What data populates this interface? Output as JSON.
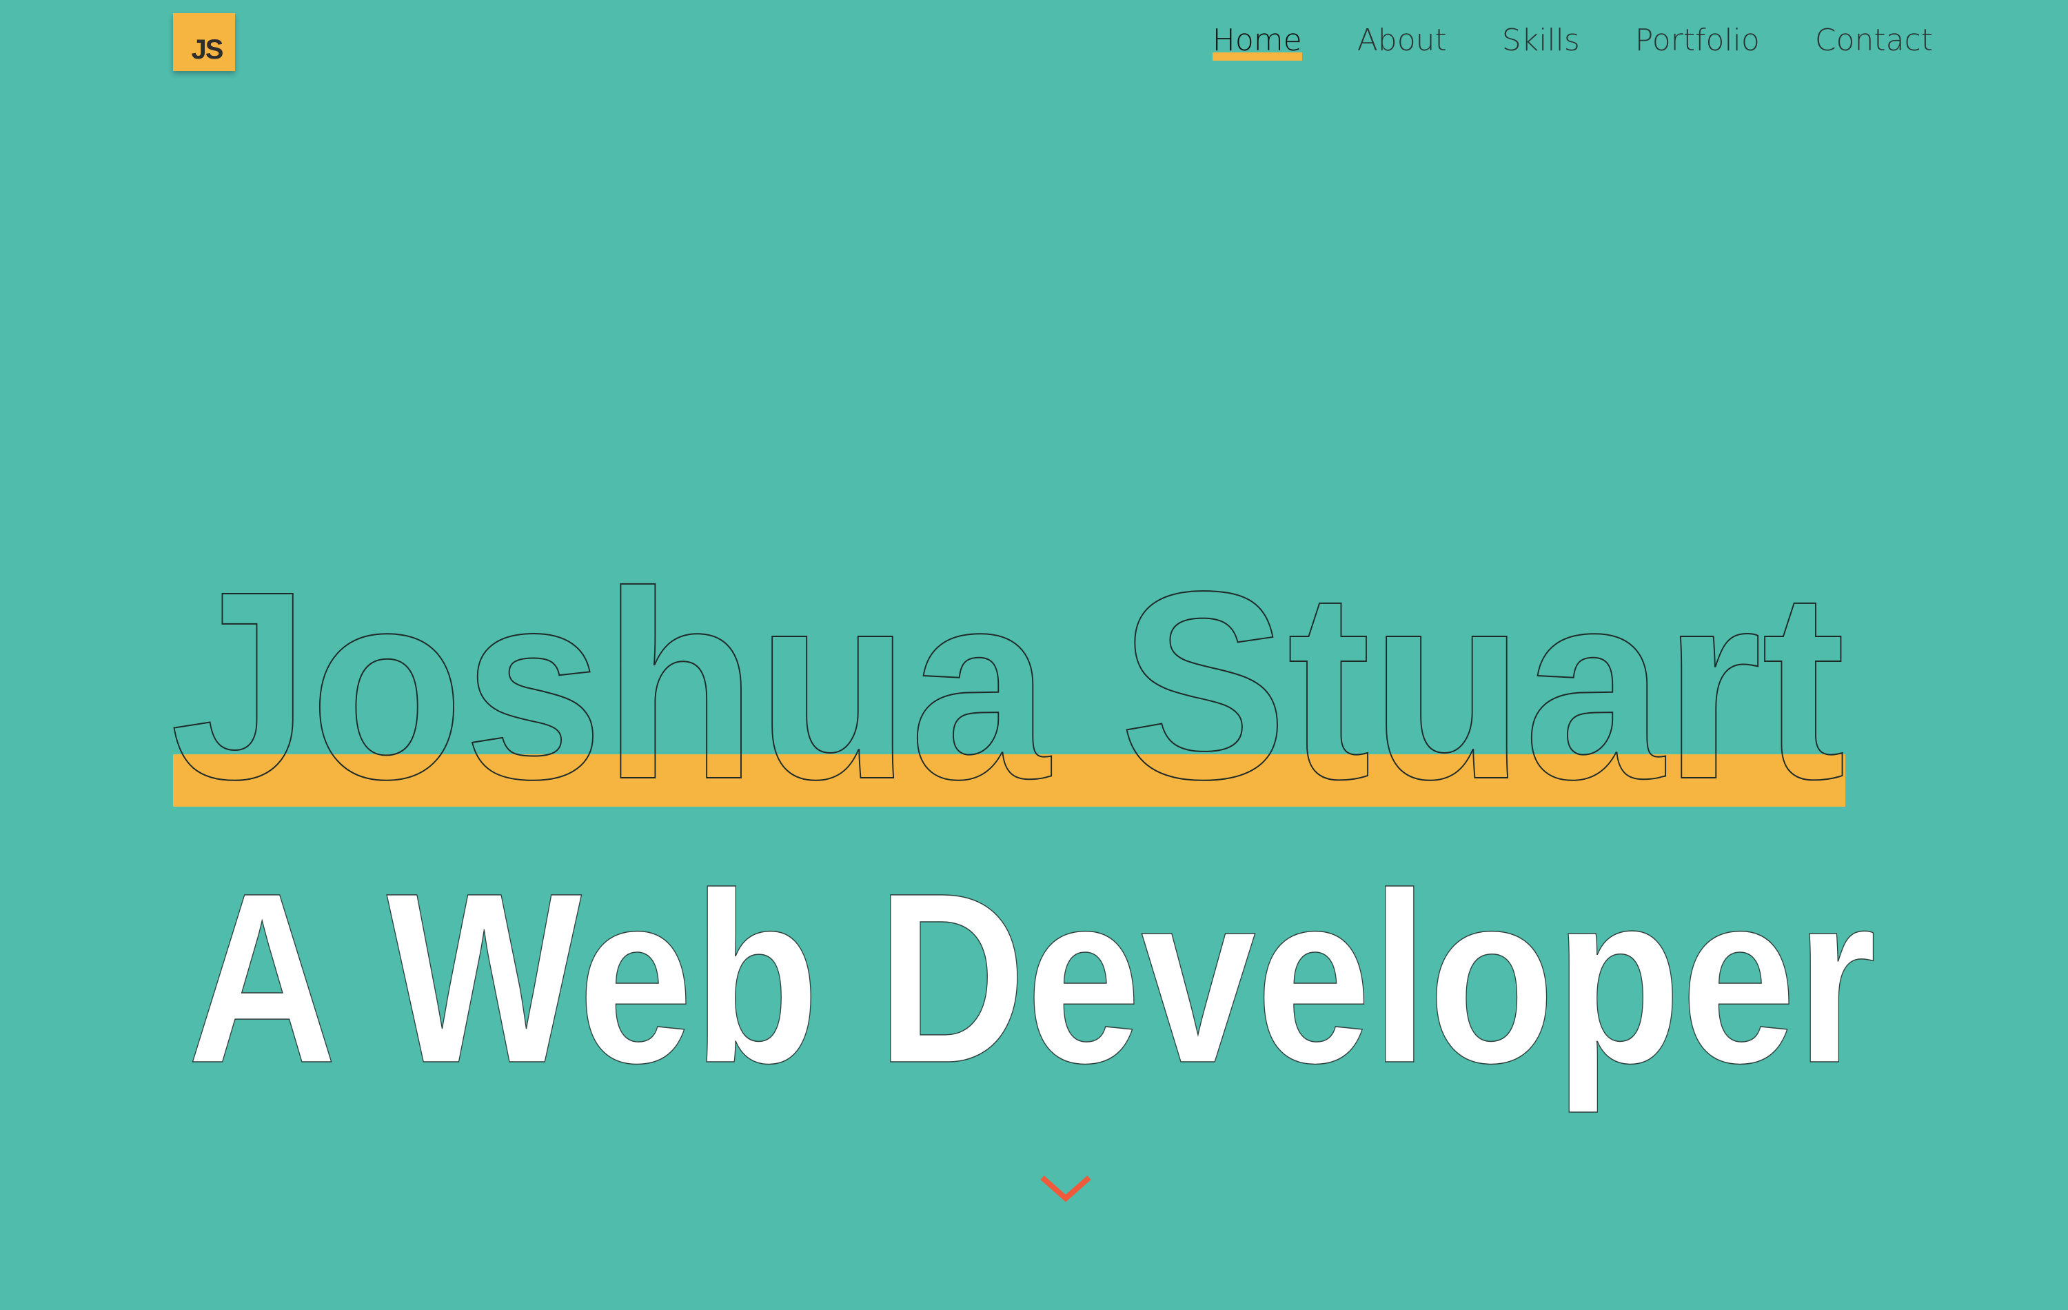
{
  "logo": {
    "text": "JS",
    "color": "#f6b541"
  },
  "nav": {
    "items": [
      {
        "label": "Home",
        "active": true
      },
      {
        "label": "About",
        "active": false
      },
      {
        "label": "Skills",
        "active": false
      },
      {
        "label": "Portfolio",
        "active": false
      },
      {
        "label": "Contact",
        "active": false
      }
    ]
  },
  "hero": {
    "name": "Joshua Stuart",
    "role": "A Web Developer"
  },
  "scroll": {
    "icon": "chevron-down-icon"
  },
  "colors": {
    "background": "#50bcac",
    "accent": "#f6b541",
    "arrow": "#ee5a3a",
    "role_text": "#ffffff"
  }
}
